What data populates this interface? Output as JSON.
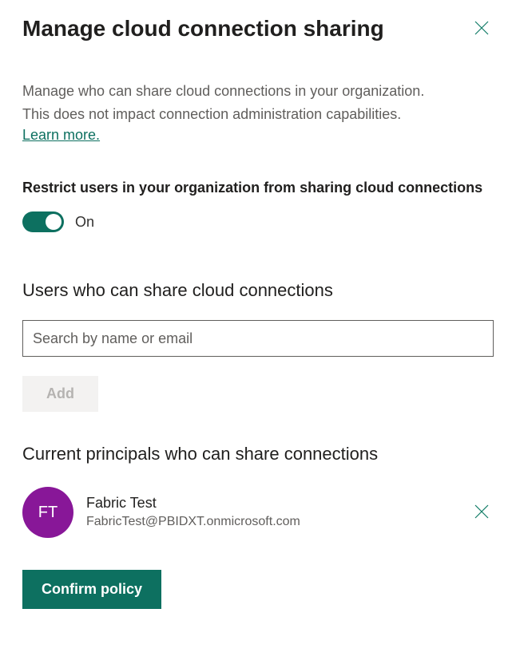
{
  "header": {
    "title": "Manage cloud connection sharing"
  },
  "description": {
    "line1": "Manage who can share cloud connections in your organization.",
    "line2": "This does not impact connection administration capabilities.",
    "learn_more": "Learn more."
  },
  "restrict": {
    "label": "Restrict users in your organization from sharing cloud connections",
    "toggle_state": "On"
  },
  "users_section": {
    "heading": "Users who can share cloud connections",
    "search_placeholder": "Search by name or email",
    "add_label": "Add"
  },
  "principals_section": {
    "heading": "Current principals who can share connections",
    "items": [
      {
        "initials": "FT",
        "name": "Fabric Test",
        "email": "FabricTest@PBIDXT.onmicrosoft.com",
        "avatar_color": "#881798"
      }
    ]
  },
  "confirm_label": "Confirm policy"
}
